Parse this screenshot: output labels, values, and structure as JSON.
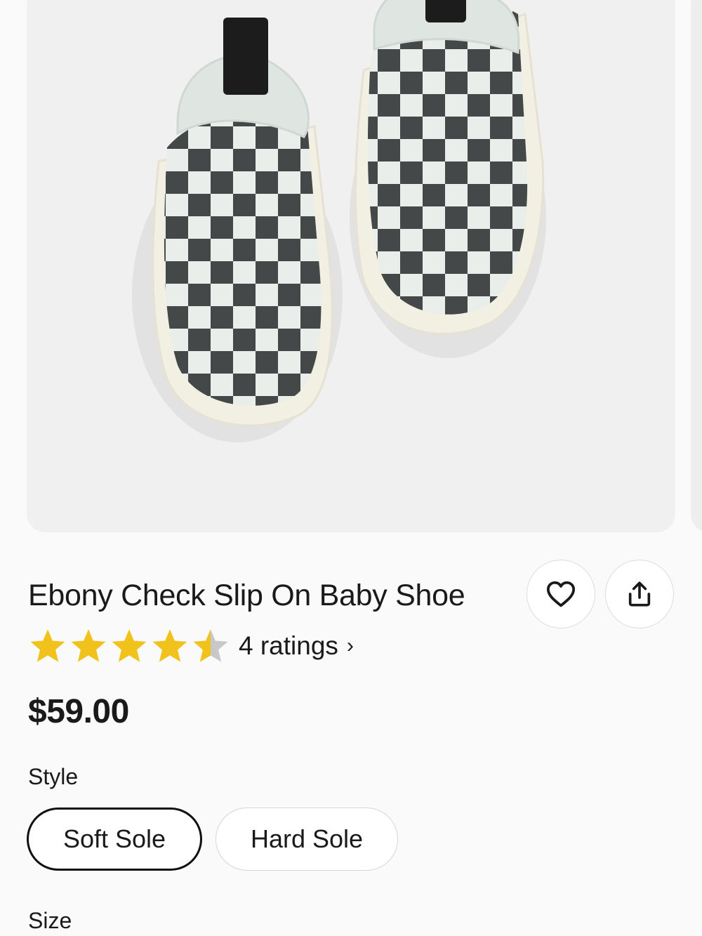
{
  "product": {
    "title": "Ebony Check Slip On Baby Shoe",
    "price": "$59.00",
    "rating": {
      "value": 4.5,
      "max": 5,
      "label": "4 ratings",
      "chevron": "›"
    }
  },
  "actions": {
    "favorite_icon": "heart-icon",
    "share_icon": "share-icon"
  },
  "style_section": {
    "label": "Style",
    "options": [
      {
        "label": "Soft Sole",
        "selected": true
      },
      {
        "label": "Hard Sole",
        "selected": false
      }
    ]
  },
  "size_section": {
    "label": "Size"
  },
  "colors": {
    "star": "#f1c21b",
    "star_empty": "#c8c8c8",
    "text": "#1a1a1a"
  }
}
